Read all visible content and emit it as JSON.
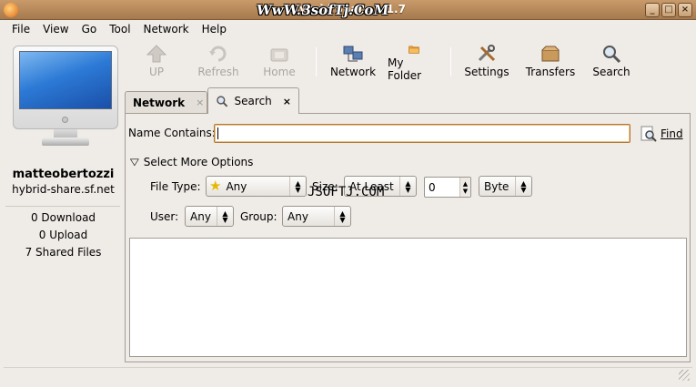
{
  "window": {
    "title": "Hybrid Share 1.1.7",
    "watermark_top": "WwW.3sofTj.CoM",
    "watermark_mid": "JSOFTJ.COM",
    "buttons": {
      "minimize": "_",
      "maximize": "□",
      "close": "×"
    }
  },
  "menu": [
    "File",
    "View",
    "Go",
    "Tool",
    "Network",
    "Help"
  ],
  "toolbar": {
    "up": "UP",
    "refresh": "Refresh",
    "home": "Home",
    "network": "Network",
    "my_folder": "My Folder",
    "settings": "Settings",
    "transfers": "Transfers",
    "search": "Search"
  },
  "user": {
    "name": "matteobertozzi",
    "host": "hybrid-share.sf.net",
    "downloads": "0 Download",
    "uploads": "0 Upload",
    "shared": "7 Shared Files"
  },
  "tabs": [
    {
      "label": "Network",
      "close": "×"
    },
    {
      "label": "Search",
      "close": "×"
    }
  ],
  "search": {
    "name_label": "Name Contains:",
    "name_value": "",
    "find_label": "Find",
    "more_options": "Select More Options",
    "file_type_label": "File Type:",
    "file_type_value": "Any",
    "size_label": "Size:",
    "size_mode_value": "At Least",
    "size_value": "0",
    "size_unit_value": "Byte",
    "user_label": "User:",
    "user_value": "Any",
    "group_label": "Group:",
    "group_value": "Any"
  },
  "colors": {
    "accent": "#b27a3a",
    "titlebar": "#b8895c",
    "screen": "#2c7ad6"
  },
  "icons": {
    "up": "up-arrow-icon",
    "refresh": "refresh-icon",
    "home": "home-icon",
    "network": "network-computers-icon",
    "my_folder": "folder-icon",
    "settings": "tools-icon",
    "transfers": "package-icon",
    "search": "magnifier-icon"
  }
}
